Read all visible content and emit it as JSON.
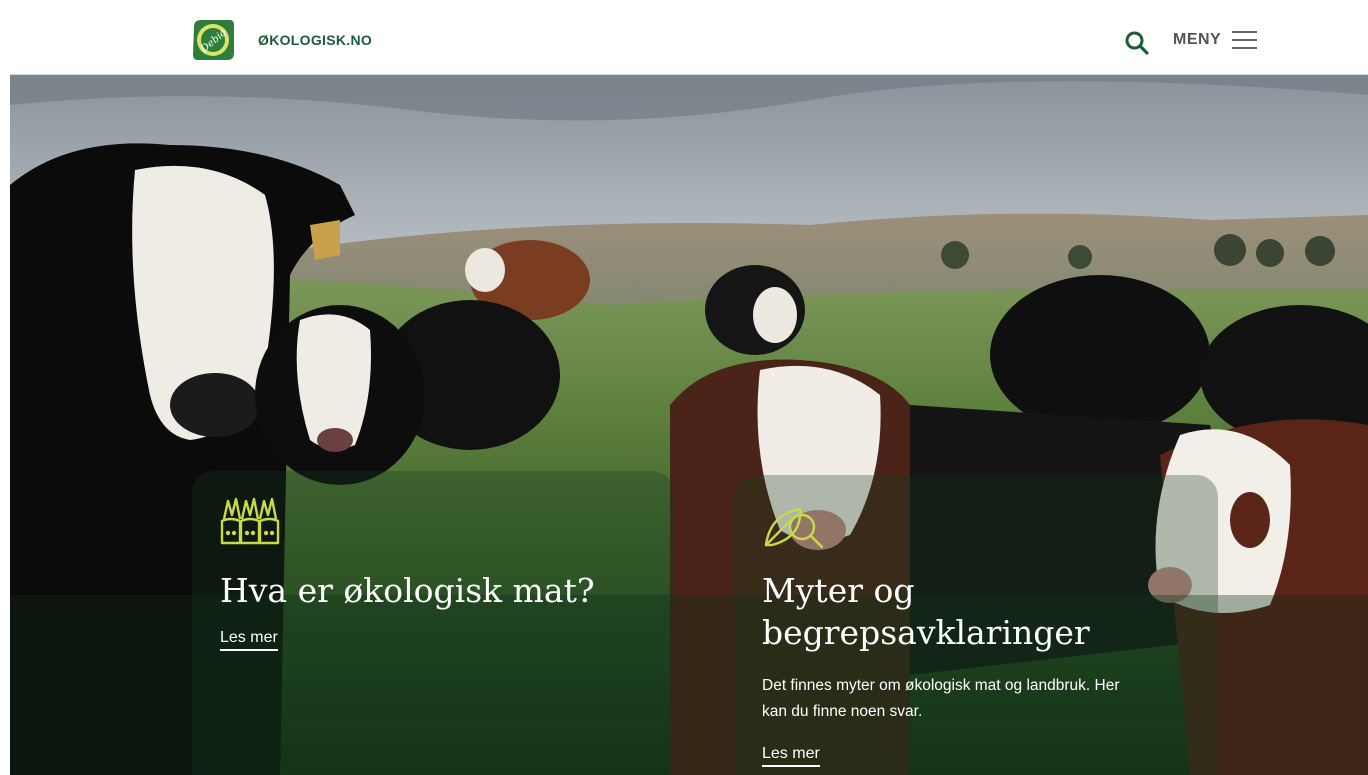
{
  "header": {
    "site_name": "ØKOLOGISK.NO",
    "logo_text": "Debio",
    "menu_label": "MENY",
    "brand_color": "#1e5b3a",
    "icons": {
      "search": "search-icon",
      "menu": "hamburger-menu-icon",
      "logo": "debio-logo"
    }
  },
  "hero": {
    "image": "cows-grazing-on-pasture",
    "cards": [
      {
        "icon": "carrots-icon",
        "title": "Hva er økologisk mat?",
        "link_label": "Les mer"
      },
      {
        "icon": "leaf-magnifier-icon",
        "title_line1": "Myter og",
        "title_line2": "begrepsavklaringer",
        "text_line1": "Det finnes myter om økologisk mat og landbruk. Her",
        "text_line2": "kan du finne noen svar.",
        "link_label": "Les mer"
      }
    ],
    "icon_color": "#c9d94a"
  }
}
